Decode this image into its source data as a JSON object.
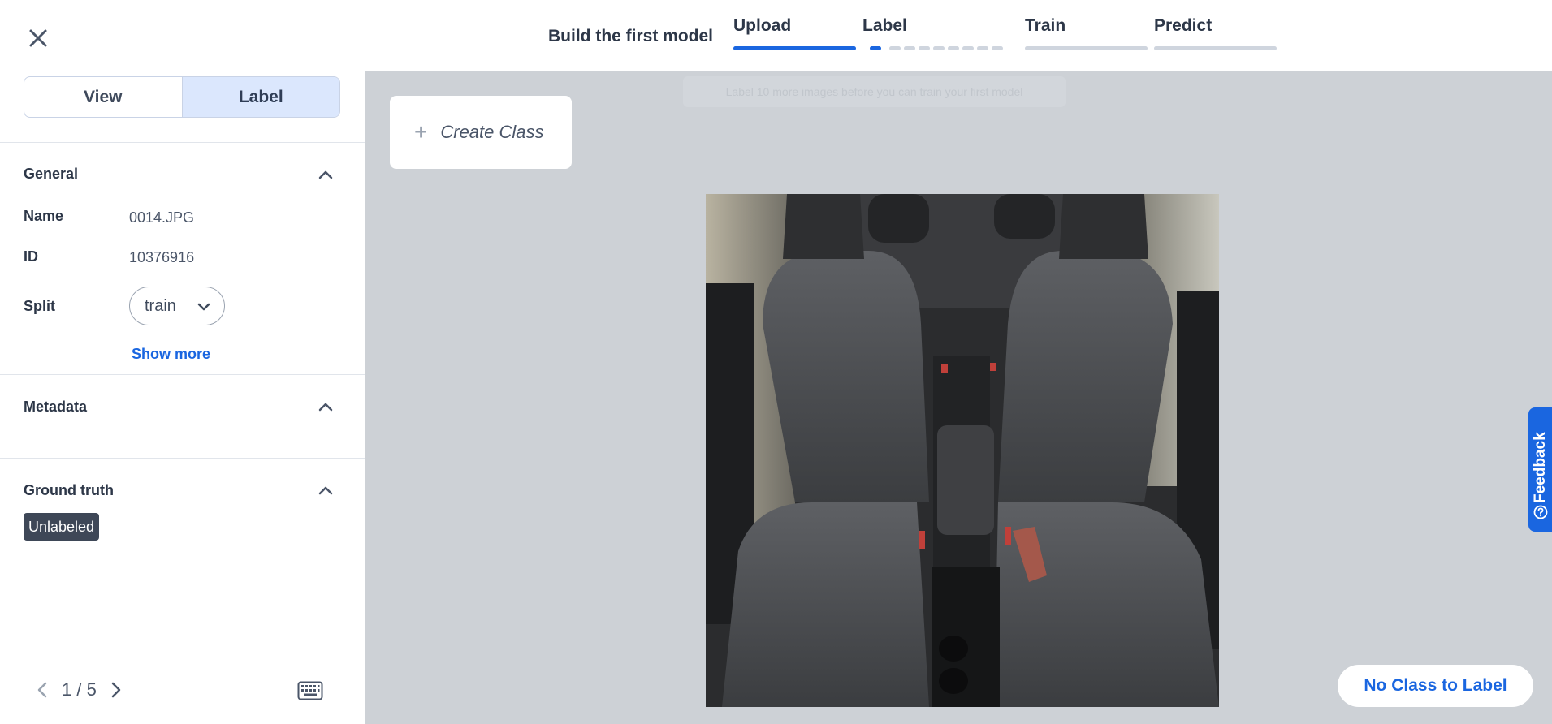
{
  "sidebar": {
    "mode_view": "View",
    "mode_label": "Label",
    "general_title": "General",
    "name_label": "Name",
    "name_value": "0014.JPG",
    "id_label": "ID",
    "id_value": "10376916",
    "split_label": "Split",
    "split_value": "train",
    "show_more": "Show more",
    "metadata_title": "Metadata",
    "ground_truth_title": "Ground truth",
    "ground_truth_badge": "Unlabeled",
    "pager": "1 / 5"
  },
  "stepper": {
    "title": "Build the first model",
    "steps": [
      "Upload",
      "Label",
      "Train",
      "Predict"
    ]
  },
  "main": {
    "hint": "Label 10 more images before you can train your first model",
    "create_class": "Create Class",
    "no_class_button": "No Class to Label",
    "feedback": "Feedback"
  },
  "colors": {
    "accent": "#1a66e0",
    "canvas_bg": "#cdd1d6"
  }
}
